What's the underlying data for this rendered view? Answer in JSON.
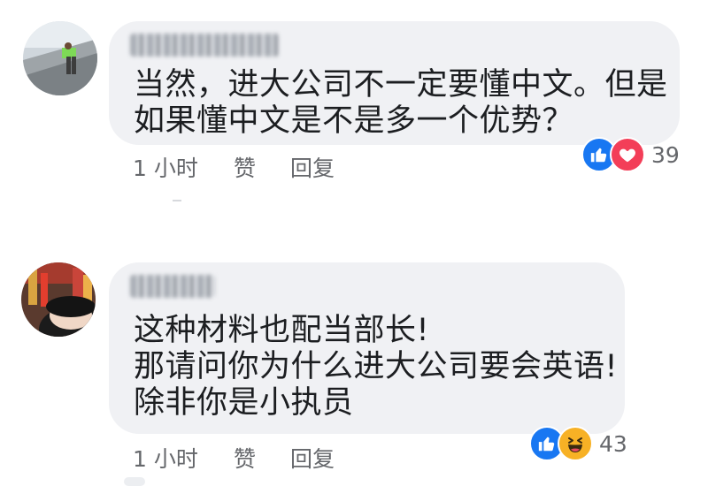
{
  "comments": [
    {
      "text": "当然，进大公司不一定要懂中文。但是\n如果懂中文是不是多一个优势？",
      "time": "1 小时",
      "like_label": "赞",
      "reply_label": "回复",
      "reactions": [
        "like-icon",
        "love-icon"
      ],
      "reaction_count": "39"
    },
    {
      "text": "这种材料也配当部长!\n那请问你为什么进大公司要会英语!\n除非你是小执员",
      "time": "1 小时",
      "like_label": "赞",
      "reply_label": "回复",
      "reactions": [
        "like-icon",
        "haha-icon"
      ],
      "reaction_count": "43"
    }
  ],
  "colors": {
    "bubble": "#f0f1f4",
    "like_blue": "#1877f2",
    "love_red": "#f33e58",
    "haha_yellow": "#f7b125",
    "meta_gray": "#65676b"
  }
}
